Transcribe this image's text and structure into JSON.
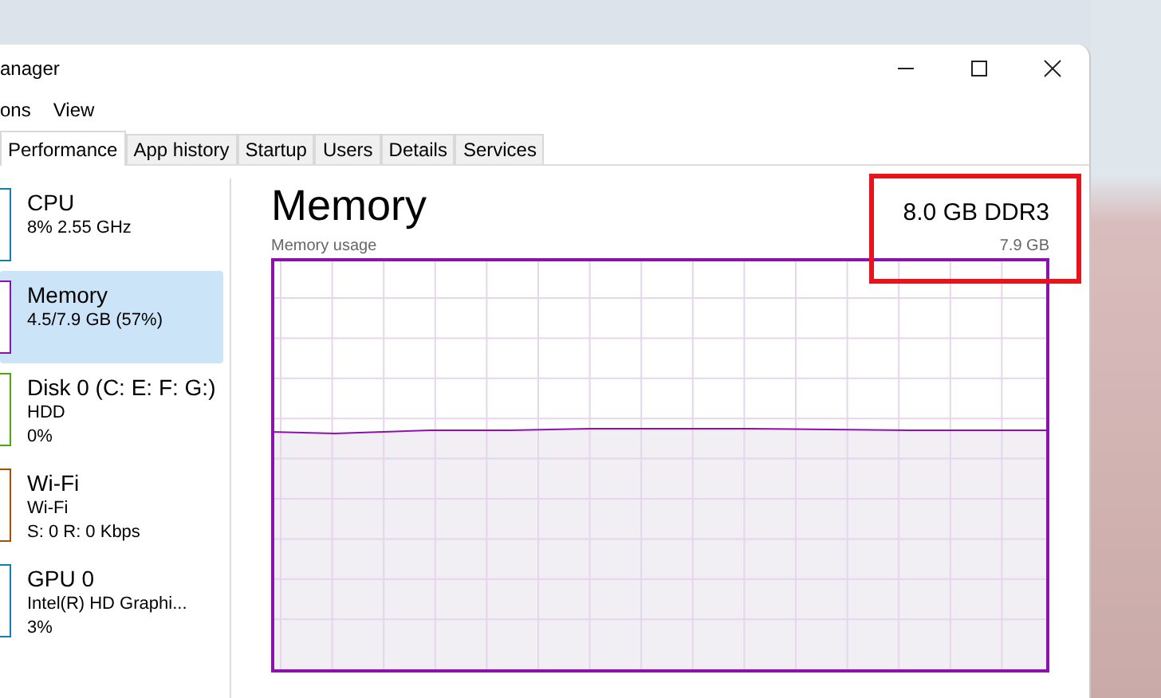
{
  "window": {
    "title": "anager"
  },
  "menu": [
    "ons",
    "View"
  ],
  "tabs": [
    {
      "label": "Performance",
      "selected": true
    },
    {
      "label": "App history",
      "selected": false
    },
    {
      "label": "Startup",
      "selected": false
    },
    {
      "label": "Users",
      "selected": false
    },
    {
      "label": "Details",
      "selected": false
    },
    {
      "label": "Services",
      "selected": false
    }
  ],
  "sidebar": {
    "items": [
      {
        "name": "CPU",
        "lines": [
          "8% 2.55 GHz"
        ],
        "color": "#117dbb",
        "selected": false
      },
      {
        "name": "Memory",
        "lines": [
          "4.5/7.9 GB (57%)"
        ],
        "color": "#8b12ae",
        "selected": true
      },
      {
        "name": "Disk 0 (C: E: F: G:)",
        "lines": [
          "HDD",
          "0%"
        ],
        "color": "#4da60c",
        "selected": false
      },
      {
        "name": "Wi-Fi",
        "lines": [
          "Wi-Fi",
          "S: 0 R: 0 Kbps"
        ],
        "color": "#a74f01",
        "selected": false
      },
      {
        "name": "GPU 0",
        "lines": [
          "Intel(R) HD Graphi...",
          "3%"
        ],
        "color": "#117dbb",
        "selected": false
      }
    ]
  },
  "main": {
    "title": "Memory",
    "spec": "8.0 GB DDR3",
    "chart_label": "Memory usage",
    "chart_max": "7.9 GB"
  }
}
